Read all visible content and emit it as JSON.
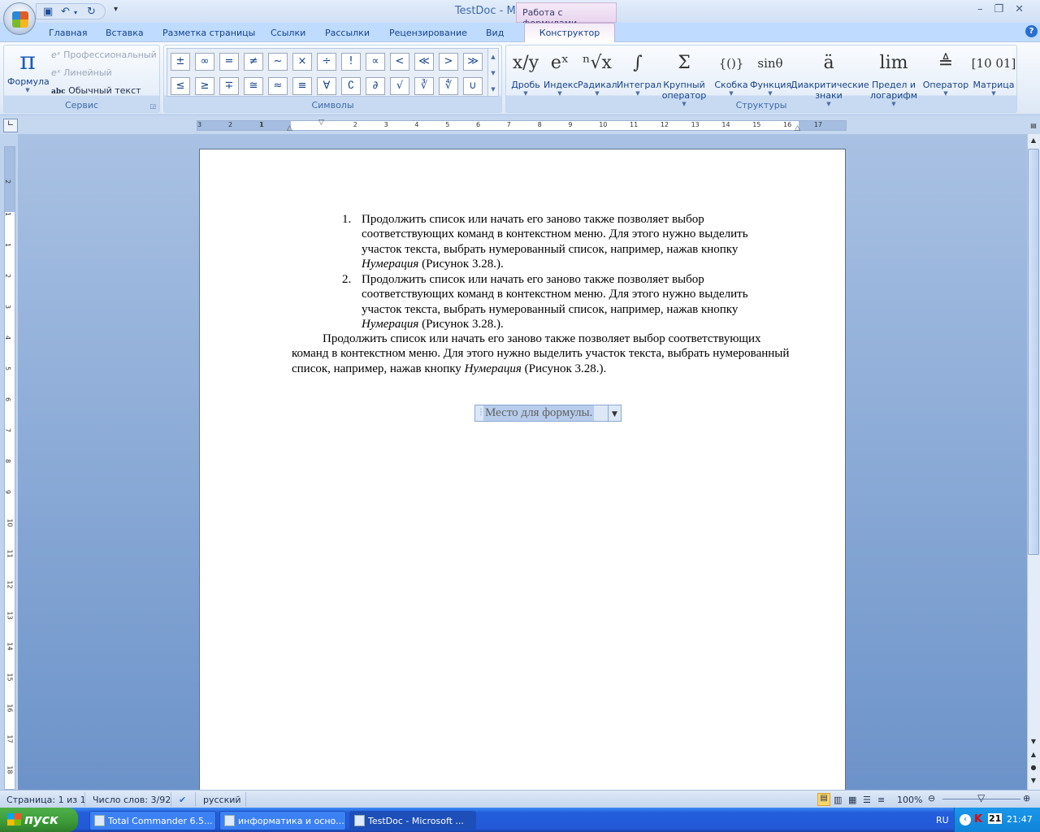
{
  "window": {
    "title": "TestDoc - Microsoft Word",
    "context_header": "Работа с формулами",
    "controls": [
      "minimize",
      "restore",
      "close"
    ]
  },
  "qat": {
    "items": [
      "save-icon",
      "undo-icon",
      "redo-icon",
      "customize-icon"
    ]
  },
  "tabs": [
    "Главная",
    "Вставка",
    "Разметка страницы",
    "Ссылки",
    "Рассылки",
    "Рецензирование",
    "Вид"
  ],
  "active_tab": "Конструктор",
  "ribbon": {
    "service": {
      "label": "Сервис",
      "formula": "Формула",
      "professional": "Профессиональный",
      "linear": "Линейный",
      "normal_text": "Обычный текст",
      "abc": "abc"
    },
    "symbols": {
      "label": "Символы",
      "row1": [
        "±",
        "∞",
        "=",
        "≠",
        "~",
        "×",
        "÷",
        "!",
        "∝",
        "<",
        "≪",
        ">",
        "≫"
      ],
      "row2": [
        "≤",
        "≥",
        "∓",
        "≅",
        "≈",
        "≡",
        "∀",
        "∁",
        "∂",
        "√",
        "∛",
        "∜",
        "∪"
      ]
    },
    "structures": {
      "label": "Структуры",
      "items": [
        {
          "glyph": "x/y",
          "label": "Дробь"
        },
        {
          "glyph": "eˣ",
          "label": "Индекс"
        },
        {
          "glyph": "ⁿ√x",
          "label": "Радикал"
        },
        {
          "glyph": "∫",
          "label": "Интеграл"
        },
        {
          "glyph": "Σ",
          "label": "Крупный оператор"
        },
        {
          "glyph": "{()}",
          "label": "Скобка"
        },
        {
          "glyph": "sinθ",
          "label": "Функция"
        },
        {
          "glyph": "ä",
          "label": "Диакритические знаки"
        },
        {
          "glyph": "lim",
          "label": "Предел и логарифм"
        },
        {
          "glyph": "≜",
          "label": "Оператор"
        },
        {
          "glyph": "[10 01]",
          "label": "Матрица"
        }
      ]
    }
  },
  "ruler": {
    "h_numbers": [
      "3",
      "2",
      "1",
      "1",
      "2",
      "3",
      "4",
      "5",
      "6",
      "7",
      "8",
      "9",
      "10",
      "11",
      "12",
      "13",
      "14",
      "15",
      "16",
      "17"
    ],
    "v_numbers": [
      "2",
      "1",
      "1",
      "2",
      "3",
      "4",
      "5",
      "6",
      "7",
      "8",
      "9",
      "10",
      "11",
      "12",
      "13",
      "14",
      "15",
      "16",
      "17",
      "18"
    ]
  },
  "document": {
    "list": [
      {
        "num": "1.",
        "text": "Продолжить список или начать его заново также позволяет выбор соответствующих команд в контекстном меню. Для этого нужно выделить участок текста, выбрать нумерованный список, например, нажав кнопку ",
        "italic": "Нумерация",
        "tail": " (Рисунок 3.28.)."
      },
      {
        "num": "2.",
        "text": "Продолжить список или начать его заново также позволяет выбор соответствующих команд в контекстном меню. Для этого нужно выделить участок текста, выбрать нумерованный список, например, нажав кнопку ",
        "italic": "Нумерация",
        "tail": " (Рисунок 3.28.)."
      }
    ],
    "paragraph": {
      "text": "Продолжить список или начать его заново также позволяет выбор соответствующих команд в контекстном меню. Для этого нужно выделить участок текста, выбрать нумерованный список, например, нажав кнопку ",
      "italic": "Нумерация",
      "tail": " (Рисунок 3.28.)."
    },
    "equation_placeholder": "Место для формулы."
  },
  "status": {
    "page": "Страница: 1 из 1",
    "words": "Число слов: 3/92",
    "language": "русский",
    "zoom": "100%",
    "zoom_level_percent": 100
  },
  "taskbar": {
    "start": "пуск",
    "tasks": [
      "Total Commander 6.5...",
      "информатика и осно...",
      "TestDoc - Microsoft ..."
    ],
    "active_task": 2,
    "lang": "RU",
    "tray_badge": "21",
    "time": "21:47"
  }
}
